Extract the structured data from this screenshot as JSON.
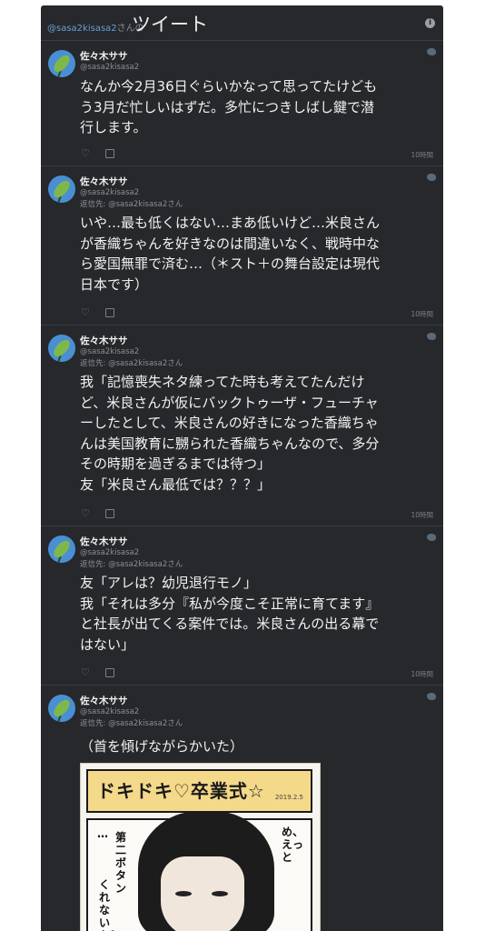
{
  "header": {
    "handle": "@sasa2kisasa2",
    "handle_suffix": "さんの",
    "title": "ツイート"
  },
  "tweets": [
    {
      "name": "佐々木ササ",
      "handle": "@sasa2kisasa2",
      "reply_to": "",
      "text": "なんか今2月36日ぐらいかなって思ってたけども\nう3月だ忙しいはずだ。多忙につきしばし鍵で潜\n行します。",
      "time": "10時間"
    },
    {
      "name": "佐々木ササ",
      "handle": "@sasa2kisasa2",
      "reply_label": "返信先:",
      "reply_handle": "@sasa2kisasa2さん",
      "text": "いや…最も低くはない…まあ低いけど…米良さん\nが香織ちゃんを好きなのは間違いなく、戦時中な\nら愛国無罪で済む…（＊スト＋の舞台設定は現代\n日本です）",
      "time": "10時間"
    },
    {
      "name": "佐々木ササ",
      "handle": "@sasa2kisasa2",
      "reply_label": "返信先:",
      "reply_handle": "@sasa2kisasa2さん",
      "text": "我「記憶喪失ネタ練ってた時も考えてたんだけ\nど、米良さんが仮にバックトゥーザ・フューチャ\nーしたとして、米良さんの好きになった香織ちゃ\nんは美国教育に嬲られた香織ちゃんなので、多分\nその時期を過ぎるまでは待つ」\n友「米良さん最低では？？？」",
      "time": "10時間"
    },
    {
      "name": "佐々木ササ",
      "handle": "@sasa2kisasa2",
      "reply_label": "返信先:",
      "reply_handle": "@sasa2kisasa2さん",
      "text": "友「アレは？幼児退行モノ」\n我「それは多分『私が今度こそ正常に育てます』\nと社長が出てくる案件では。米良さんの出る幕で\nはない」",
      "time": "10時間"
    },
    {
      "name": "佐々木ササ",
      "handle": "@sasa2kisasa2",
      "reply_label": "返信先:",
      "reply_handle": "@sasa2kisasa2さん",
      "text": "（首を傾げながらかいた）",
      "time": ""
    }
  ],
  "media": {
    "banner_title": "ドキドキ♡卒業式☆",
    "banner_date": "2019.2.5",
    "speech_left_1": "…",
    "speech_left_2": "第二ボタン",
    "speech_left_3": "くれないか？",
    "speech_right": "め、えっと"
  }
}
